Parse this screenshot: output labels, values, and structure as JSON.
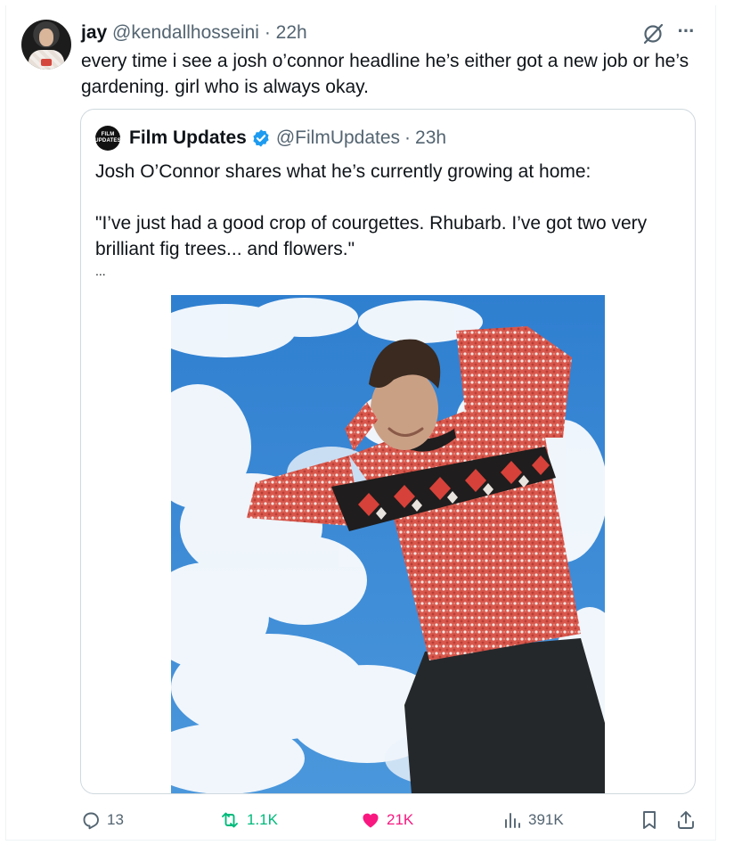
{
  "tweet": {
    "author_name": "jay",
    "author_handle": "@kendallhosseini",
    "separator": "·",
    "time": "22h",
    "text": "every time i see a josh o’connor headline he’s either got a new job or he’s gardening. girl who is always okay."
  },
  "quoted": {
    "avatar_text": "FILM UPDATES",
    "author_name": "Film Updates",
    "author_handle": "@FilmUpdates",
    "separator": "·",
    "time": "23h",
    "lines": [
      "Josh O’Connor shares what he’s currently growing at home:",
      "\"I’ve just had a good crop of courgettes. Rhubarb. I’ve got two very brilliant fig trees... and flowers.\"",
      "..."
    ]
  },
  "actions": {
    "replies": "13",
    "reposts": "1.1K",
    "likes": "21K",
    "views": "391K"
  },
  "colors": {
    "text": "#0f1419",
    "muted": "#536471",
    "border": "#cfd9de",
    "verified": "#1d9bf0",
    "repost": "#00ba7c",
    "like": "#f91880"
  },
  "icons": [
    "grok-icon",
    "more-icon",
    "verified-badge-icon",
    "reply-icon",
    "repost-icon",
    "like-icon",
    "views-icon",
    "bookmark-icon",
    "share-icon"
  ]
}
